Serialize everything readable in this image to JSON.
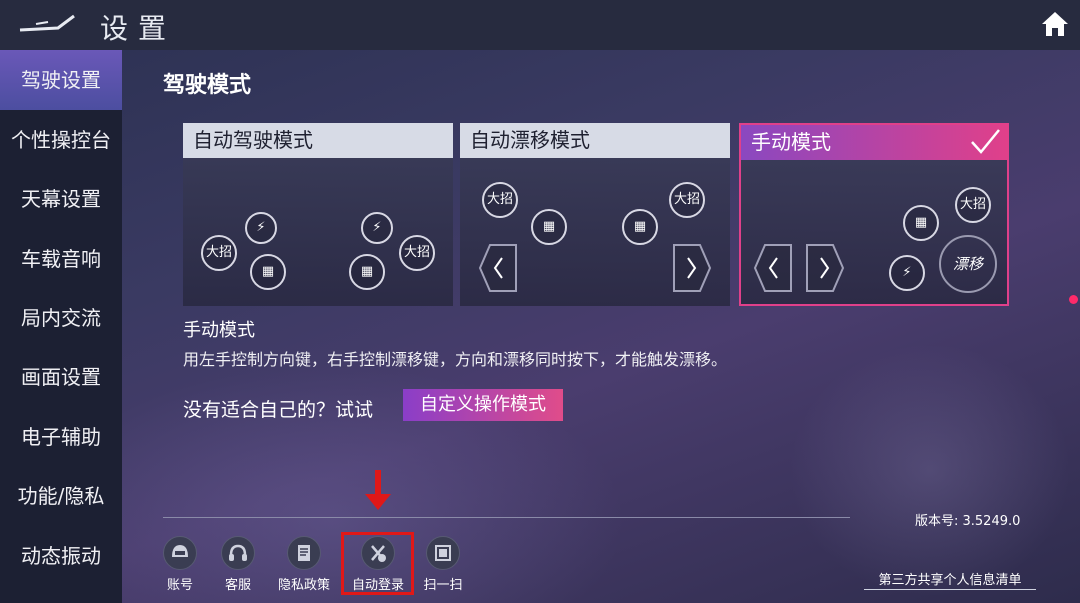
{
  "header": {
    "title": "设置"
  },
  "sidebar": {
    "items": [
      {
        "label": "驾驶设置"
      },
      {
        "label": "个性操控台"
      },
      {
        "label": "天幕设置"
      },
      {
        "label": "车载音响"
      },
      {
        "label": "局内交流"
      },
      {
        "label": "画面设置"
      },
      {
        "label": "电子辅助"
      },
      {
        "label": "功能/隐私"
      },
      {
        "label": "动态振动"
      }
    ]
  },
  "main": {
    "section_title": "驾驶模式",
    "modes": [
      {
        "label": "自动驾驶模式"
      },
      {
        "label": "自动漂移模式"
      },
      {
        "label": "手动模式"
      }
    ],
    "controls": {
      "ultimate": "大招",
      "drift": "漂移"
    },
    "selected_mode_name": "手动模式",
    "selected_mode_desc": "用左手控制方向键，右手控制漂移键，方向和漂移同时按下，才能触发漂移。",
    "try_text": "没有适合自己的？试试",
    "custom_button": "自定义操作模式"
  },
  "footer": {
    "items": [
      {
        "label": "账号",
        "icon": "helmet-icon"
      },
      {
        "label": "客服",
        "icon": "headset-icon"
      },
      {
        "label": "隐私政策",
        "icon": "document-icon"
      },
      {
        "label": "自动登录",
        "icon": "auto-login-icon"
      },
      {
        "label": "扫一扫",
        "icon": "scan-icon"
      }
    ],
    "version": "版本号: 3.5249.0",
    "privacy_list": "第三方共享个人信息清单"
  },
  "colors": {
    "accent_pink": "#e0408a",
    "accent_purple": "#8a3ec8",
    "highlight_red": "#e01818"
  }
}
